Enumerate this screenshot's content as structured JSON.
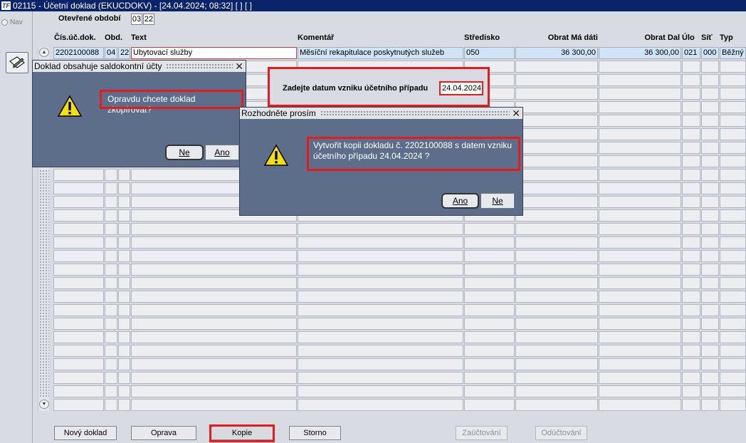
{
  "window": {
    "title": "02115 - Účetní doklad (EKUCDOKV) - [24.04.2024; 08:32] [ ] [ ]",
    "icon_text": "TF"
  },
  "left_panel": {
    "nav_label": "Nav"
  },
  "period": {
    "label": "Otevřené období",
    "value1": "03",
    "value2": "22"
  },
  "table": {
    "headers": {
      "doc_no": "Čís.úč.dok.",
      "period": "Obd.",
      "text": "Text",
      "comment": "Komentář",
      "center": "Středisko",
      "debit": "Obrat Má dáti",
      "credit": "Obrat Dal",
      "task": "Úlo",
      "net": "Síť",
      "type": "Typ"
    },
    "row": {
      "doc_no": "2202100088",
      "period_month": "04",
      "period_year": "22",
      "text": "Ubytovací služby",
      "comment": "Měsíční rekapitulace poskytnutých služeb",
      "center": "050",
      "debit": "36 300,00",
      "credit": "36 300,00",
      "task": "021",
      "net": "000",
      "type": "Běžný"
    },
    "row_count": 27
  },
  "buttons": {
    "new_doc": "Nový doklad",
    "edit": "Oprava",
    "copy": "Kopie",
    "cancel": "Storno",
    "post": "Zaúčtování",
    "unpost": "Odúčtování"
  },
  "dialog_saldo": {
    "title": "Doklad obsahuje saldokontní účty",
    "message": "Opravdu chcete doklad zkopírovat?",
    "no": "Ne",
    "yes": "Ano"
  },
  "date_prompt": {
    "label": "Zadejte datum vzniku účetního případu",
    "value": "24.04.2024"
  },
  "dialog_decide": {
    "title": "Rozhodněte prosím",
    "message_line1": "Vytvořit kopii dokladu č. 2202100088 s datem vzniku",
    "message_line2": "účetního případu 24.04.2024 ?",
    "yes": "Ano",
    "no": "Ne"
  },
  "colors": {
    "highlight": "#e81a1a",
    "dialog_bg": "#5d6e8a",
    "title_bar": "#0a246a"
  }
}
